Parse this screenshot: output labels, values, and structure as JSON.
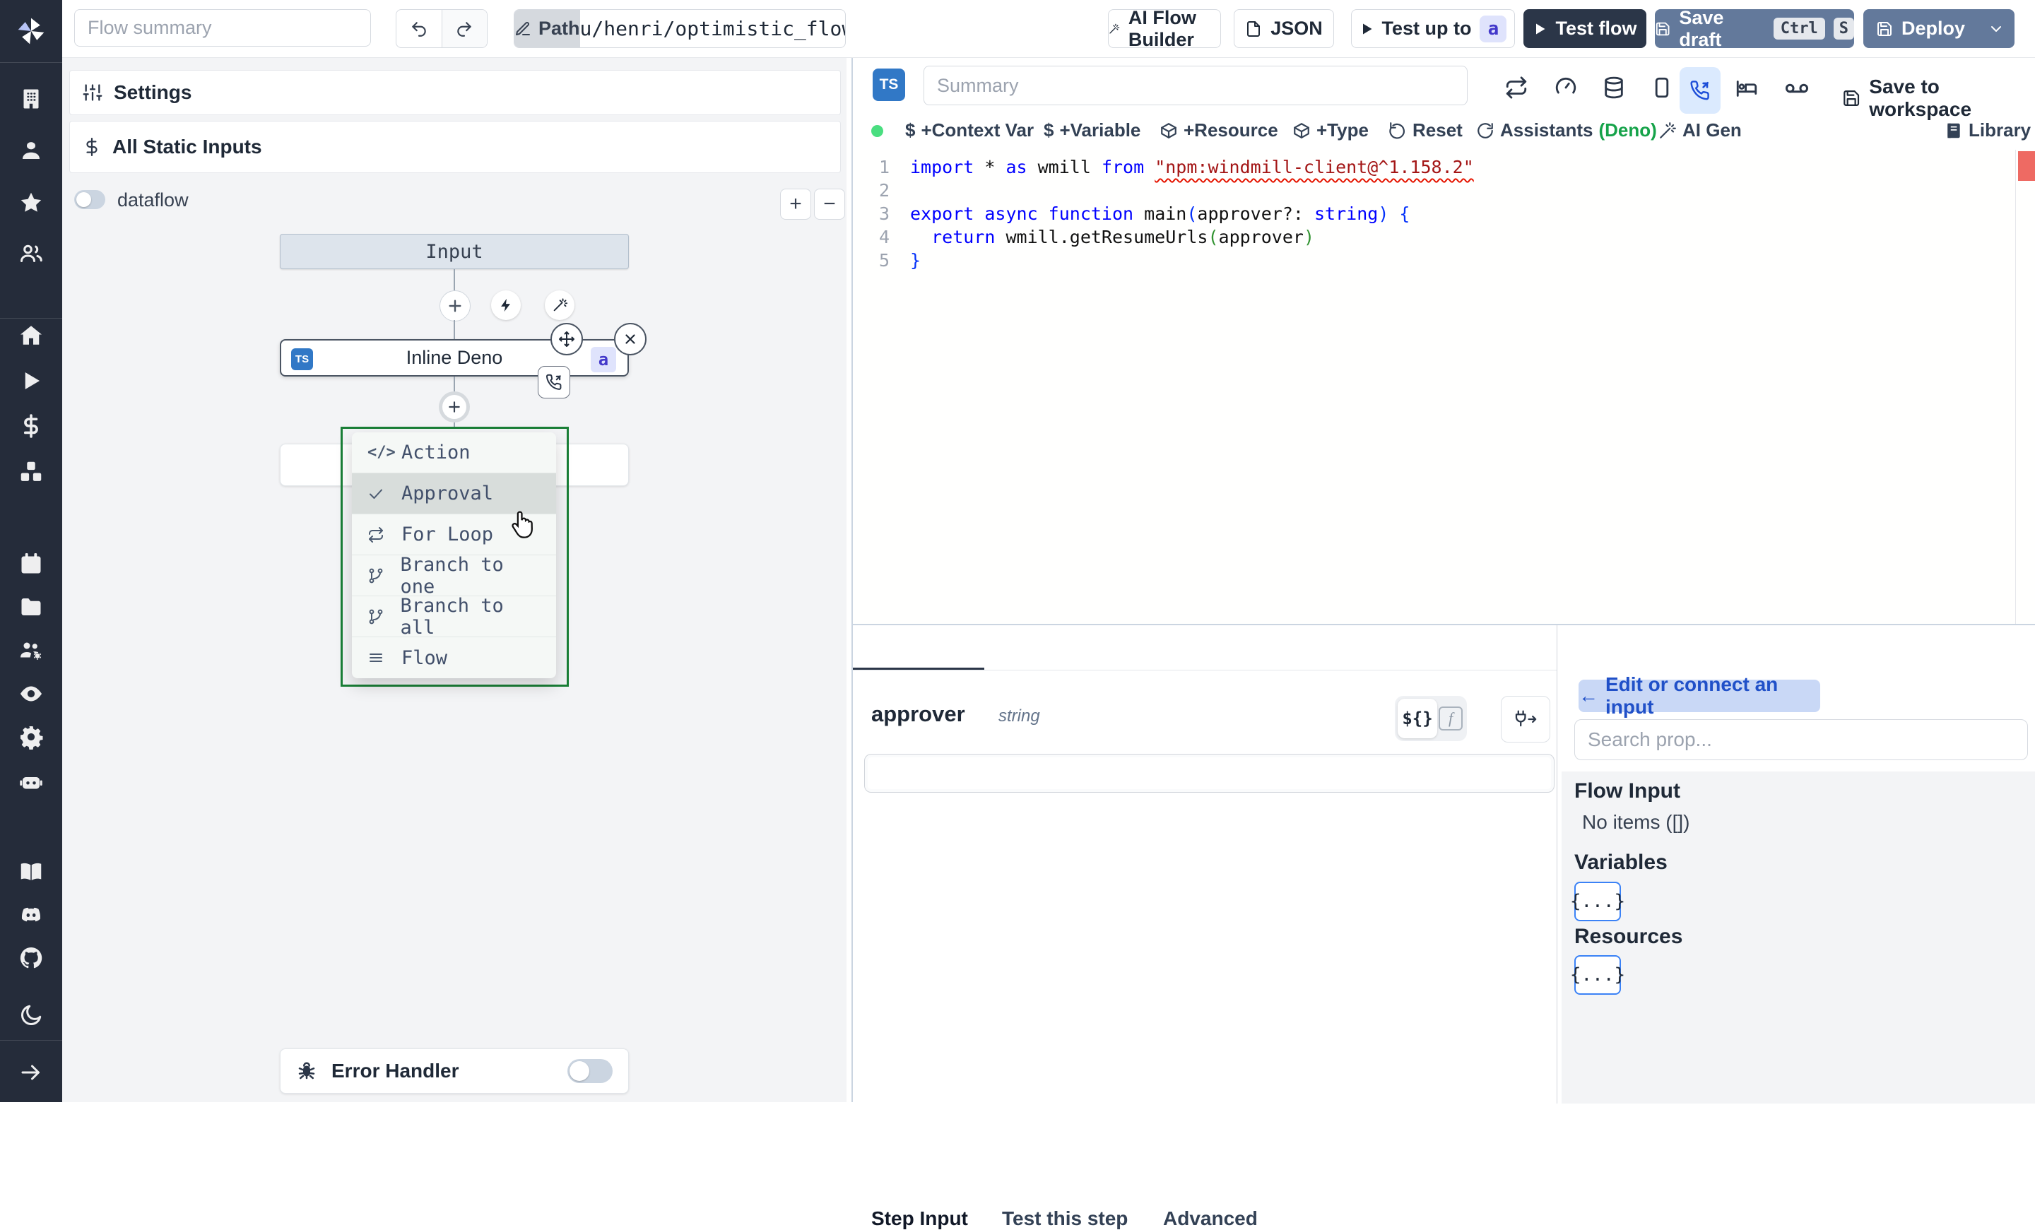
{
  "colors": {
    "rail_bg": "#252c3a",
    "accent_blue": "#3178c6",
    "menu_border": "#1a7f37",
    "slate_btn": "#63799b",
    "dark_btn": "#2b3648",
    "suspend_highlight": "#dbeafe",
    "deno_green": "#16a34a",
    "badge_bg": "#dfe3fc"
  },
  "topbar": {
    "flow_summary_placeholder": "Flow summary",
    "path_label": "Path",
    "path_value": "u/henri/optimistic_flow",
    "ai_flow_builder": "AI Flow Builder",
    "json_btn": "JSON",
    "test_up_to": "Test up to",
    "test_up_to_badge": "a",
    "test_flow": "Test flow",
    "save_draft": "Save draft",
    "kbd_ctrl": "Ctrl",
    "kbd_s": "S",
    "deploy": "Deploy"
  },
  "sidebar": {
    "icons": [
      "building",
      "user",
      "star",
      "users-group",
      "home",
      "play",
      "dollar",
      "cubes",
      "calendar",
      "folder",
      "users-gear",
      "eye",
      "gear",
      "robot",
      "book",
      "discord",
      "github",
      "moon",
      "arrow-right"
    ]
  },
  "flow": {
    "settings": "Settings",
    "all_static_inputs": "All Static Inputs",
    "dataflow": "dataflow",
    "zoom_in": "+",
    "zoom_out": "−",
    "input_node": "Input",
    "step_node": "Inline Deno",
    "step_badge": "a",
    "ts_badge": "TS",
    "error_handler": "Error Handler",
    "menu": {
      "items": [
        {
          "icon": "code",
          "label": "Action"
        },
        {
          "icon": "check",
          "label": "Approval"
        },
        {
          "icon": "repeat",
          "label": "For Loop"
        },
        {
          "icon": "git-branch",
          "label": "Branch to one"
        },
        {
          "icon": "git-branch",
          "label": "Branch to all"
        },
        {
          "icon": "menu-lines",
          "label": "Flow"
        }
      ]
    }
  },
  "editor": {
    "ts_badge": "TS",
    "summary_placeholder": "Summary",
    "save_to_workspace": "Save to workspace",
    "actions": {
      "context_var": "+Context Var",
      "variable": "+Variable",
      "resource": "+Resource",
      "type": "+Type",
      "reset": "Reset",
      "assistants": "Assistants",
      "assistants_lang": "(Deno)",
      "ai_gen": "AI Gen",
      "library": "Library"
    },
    "line_numbers": [
      "1",
      "2",
      "3",
      "4",
      "5"
    ],
    "code": {
      "lines": [
        [
          {
            "t": "import ",
            "c": "kw"
          },
          {
            "t": "* ",
            "c": "pl"
          },
          {
            "t": "as ",
            "c": "kw"
          },
          {
            "t": "wmill ",
            "c": "pl"
          },
          {
            "t": "from ",
            "c": "kw"
          },
          {
            "t": "\"npm:windmill-client@^1.158.2\"",
            "c": "str"
          }
        ],
        [],
        [
          {
            "t": "export ",
            "c": "kw"
          },
          {
            "t": "async ",
            "c": "kw"
          },
          {
            "t": "function ",
            "c": "kw"
          },
          {
            "t": "main",
            "c": "pl"
          },
          {
            "t": "(",
            "c": "b1"
          },
          {
            "t": "approver?: ",
            "c": "pl"
          },
          {
            "t": "string",
            "c": "kw"
          },
          {
            "t": ")",
            "c": "b1"
          },
          {
            "t": " {",
            "c": "b1"
          }
        ],
        [
          {
            "t": "  ",
            "c": "pl"
          },
          {
            "t": "return ",
            "c": "kw"
          },
          {
            "t": "wmill.getResumeUrls",
            "c": "pl"
          },
          {
            "t": "(",
            "c": "b2"
          },
          {
            "t": "approver",
            "c": "pl"
          },
          {
            "t": ")",
            "c": "b2"
          }
        ],
        [
          {
            "t": "}",
            "c": "b1"
          }
        ]
      ]
    }
  },
  "bottom": {
    "tabs": [
      "Step Input",
      "Test this step",
      "Advanced"
    ],
    "arg_name": "approver",
    "arg_type": "string",
    "expr_toggle": "${}",
    "fn_toggle": "f",
    "connect_btn_arrow": "←",
    "connect_btn": "Edit or connect an input",
    "search_placeholder": "Search prop...",
    "flow_input_title": "Flow Input",
    "flow_input_empty": "No items ([])",
    "variables_title": "Variables",
    "variables_chip": "{...}",
    "resources_title": "Resources",
    "resources_chip": "{...}"
  }
}
